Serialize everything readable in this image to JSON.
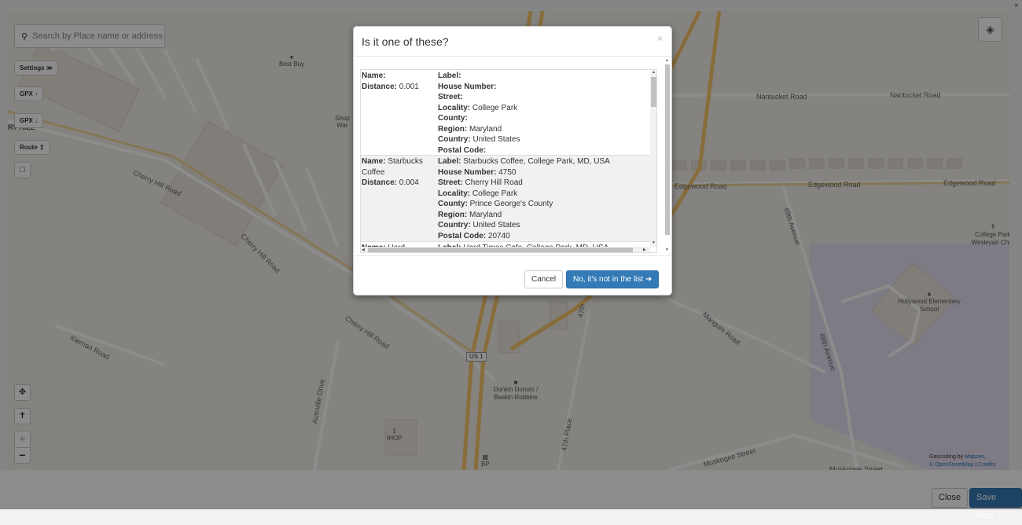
{
  "search": {
    "placeholder": "Search by Place name or address"
  },
  "controls": {
    "settings_label": "Settings ≫",
    "gpx_upload_label": "GPX",
    "gpx_download_label": "GPX",
    "route_label": "Route"
  },
  "map": {
    "labels": {
      "best_buy": "Best Buy",
      "cherry_hill_road_1": "Cherry Hill Road",
      "cherry_hill_road_2": "Cherry Hill Road",
      "cherry_hill_road_3": "Cherry Hill Road",
      "kiernan_road": "Kiernan Road",
      "autoville_drive": "Autoville Drive",
      "us1": "US 1",
      "dunkin": "Dunkin Donuts / Baskin Robbins",
      "ihop": "IHOP",
      "bp": "BP",
      "place_47th": "47th Place",
      "street_47th": "47th",
      "nantucket_road_1": "Nantucket Road",
      "nantucket_road_2": "Nantucket Road",
      "edgewood_road_1": "Edgewood Road",
      "edgewood_road_2": "Edgewood Road",
      "edgewood_road_3": "Edgewood Road",
      "avenue_49th_1": "49th Avenue",
      "avenue_49th_2": "49th Avenue",
      "muskogee_street": "Muskogee Street",
      "mangum_road": "Mangum Road",
      "college_park_church": "College Park Wesleyan Chur",
      "hollywood_school": "Hollywood Elementary School",
      "shop_partial": "Shop",
      "war_partial": "War",
      "ry_hill_partial": "RY HILL"
    }
  },
  "modal": {
    "title": "Is it one of these?",
    "close": "×",
    "results": [
      {
        "name": "",
        "distance": "0.001",
        "label": "",
        "house_number": "",
        "street": "",
        "locality": "College Park",
        "county": "",
        "region": "Maryland",
        "country": "United States",
        "postal_code": ""
      },
      {
        "name": "Starbucks Coffee",
        "distance": "0.004",
        "label": "Starbucks Coffee, College Park, MD, USA",
        "house_number": "4750",
        "street": "Cherry Hill Road",
        "locality": "College Park",
        "county": "Prince George's County",
        "region": "Maryland",
        "country": "United States",
        "postal_code": "20740"
      },
      {
        "name": "Hard",
        "label": "Hard Times Cafe, College Park, MD, USA"
      }
    ],
    "field_labels": {
      "name": "Name:",
      "distance": "Distance:",
      "label": "Label:",
      "house_number": "House Number:",
      "street": "Street:",
      "locality": "Locality:",
      "county": "County:",
      "region": "Region:",
      "country": "Country:",
      "postal_code": "Postal Code:"
    },
    "cancel_label": "Cancel",
    "not_in_list_label": "No, it's not in the list ➜"
  },
  "attribution": {
    "prefix": "Geocoding by ",
    "mapzen": "Mapzen",
    "osm": "© OpenStreetMap",
    "sep": " | ",
    "credits": "Credits"
  },
  "footer": {
    "close_label": "Close",
    "save_label": "Save Map"
  },
  "window_close": "×",
  "colors": {
    "primary": "#337ab7",
    "map_bg": "#f3efe8",
    "road_major": "#f7c66e",
    "overlay": "rgba(0,0,0,0.45)"
  }
}
